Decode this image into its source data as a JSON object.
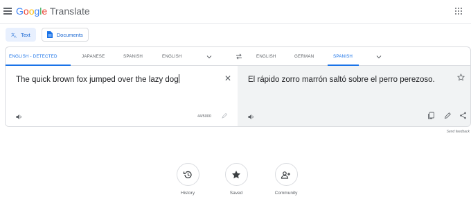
{
  "header": {
    "logo_google": "Google",
    "logo_translate": "Translate",
    "menu_icon": "hamburger-menu-icon",
    "apps_icon": "apps-grid-icon"
  },
  "modes": [
    {
      "label": "Text",
      "icon": "translate-icon",
      "active": true
    },
    {
      "label": "Documents",
      "icon": "document-icon",
      "active": false
    }
  ],
  "source_languages": [
    {
      "label": "ENGLISH - DETECTED",
      "active": true
    },
    {
      "label": "JAPANESE",
      "active": false
    },
    {
      "label": "SPANISH",
      "active": false
    },
    {
      "label": "ENGLISH",
      "active": false
    }
  ],
  "target_languages": [
    {
      "label": "ENGLISH",
      "active": false
    },
    {
      "label": "GERMAN",
      "active": false
    },
    {
      "label": "SPANISH",
      "active": true
    }
  ],
  "source": {
    "text": "The quick brown fox jumped over the lazy dog",
    "clear_glyph": "✕",
    "char_count": "44/5000"
  },
  "target": {
    "text": "El rápido zorro marrón saltó sobre el perro perezoso."
  },
  "feedback": "Send feedback",
  "bottom_buttons": [
    {
      "label": "History",
      "icon": "history-icon"
    },
    {
      "label": "Saved",
      "icon": "star-icon"
    },
    {
      "label": "Community",
      "icon": "community-icon"
    }
  ],
  "colors": {
    "accent": "#1a73e8",
    "active_mode_bg": "#e8f0fe",
    "target_panel_bg": "#f1f3f4",
    "border": "#dadce0",
    "icon_grey": "#5f6368"
  }
}
